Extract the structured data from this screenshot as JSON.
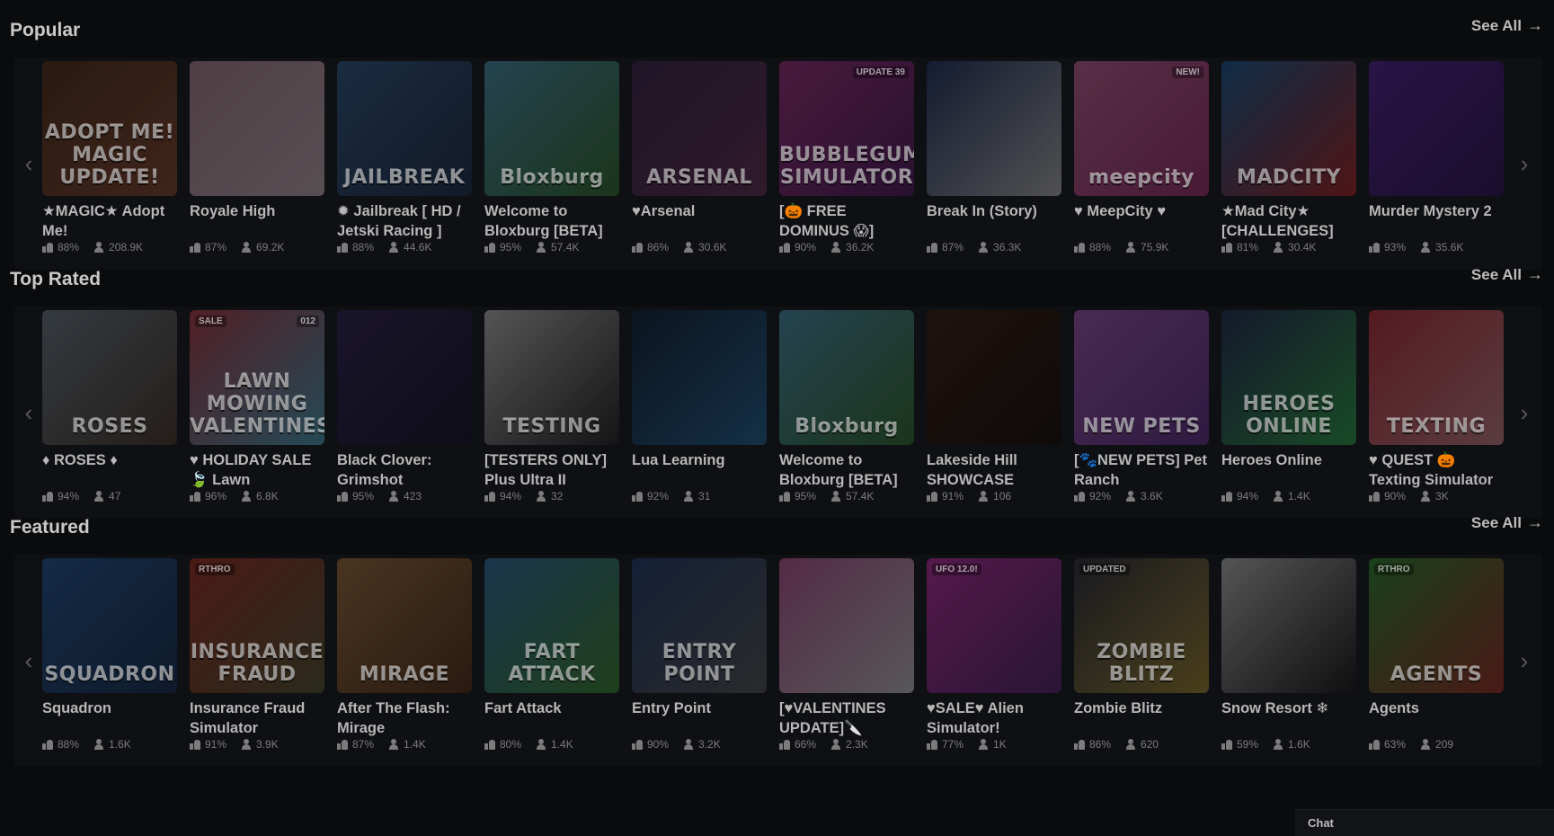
{
  "sections": [
    {
      "title": "Popular",
      "see_all": "See All",
      "games": [
        {
          "name": "★MAGIC★ Adopt Me!",
          "likes": "88%",
          "players": "208.9K",
          "thumb_text": "ADOPT ME! MAGIC UPDATE!",
          "colors": [
            "#6b3a1c",
            "#a8593a"
          ]
        },
        {
          "name": "Royale High",
          "likes": "87%",
          "players": "69.2K",
          "thumb_text": "",
          "colors": [
            "#d9a9b8",
            "#f3d6de"
          ]
        },
        {
          "name": "✹ Jailbreak [ HD / Jetski Racing ]",
          "likes": "88%",
          "players": "44.6K",
          "thumb_text": "JAILBREAK",
          "colors": [
            "#3d6ea8",
            "#243a5f"
          ]
        },
        {
          "name": "Welcome to Bloxburg [BETA]",
          "likes": "95%",
          "players": "57.4K",
          "thumb_text": "Bloxburg",
          "colors": [
            "#5db3d8",
            "#3c8a3a"
          ]
        },
        {
          "name": "♥Arsenal",
          "likes": "86%",
          "players": "30.6K",
          "thumb_text": "ARSENAL",
          "colors": [
            "#4b2d5a",
            "#7c3a6a"
          ]
        },
        {
          "name": "[🎃 FREE DOMINUS 😱]",
          "likes": "90%",
          "players": "36.2K",
          "thumb_text": "BUBBLEGUM SIMULATOR",
          "tag": "UPDATE 39",
          "colors": [
            "#c43a9e",
            "#6a1d7a"
          ]
        },
        {
          "name": "Break In (Story)",
          "likes": "87%",
          "players": "36.3K",
          "thumb_text": "",
          "colors": [
            "#2a3f7a",
            "#dcdcdc"
          ]
        },
        {
          "name": "♥ MeepCity ♥",
          "likes": "88%",
          "players": "75.9K",
          "thumb_text": "meepcity",
          "tag": "NEW!",
          "colors": [
            "#f07ab8",
            "#c63a8a"
          ]
        },
        {
          "name": "★Mad City★ [CHALLENGES]",
          "likes": "81%",
          "players": "30.4K",
          "thumb_text": "MADCITY",
          "colors": [
            "#1d6fb8",
            "#d82a2a"
          ]
        },
        {
          "name": "Murder Mystery 2",
          "likes": "93%",
          "players": "35.6K",
          "thumb_text": "",
          "colors": [
            "#6a2ab8",
            "#3a1670"
          ]
        }
      ]
    },
    {
      "title": "Top Rated",
      "see_all": "See All",
      "games": [
        {
          "name": "♦ ROSES ♦",
          "likes": "94%",
          "players": "47",
          "thumb_text": "ROSES",
          "colors": [
            "#8a9aa8",
            "#5a4636"
          ]
        },
        {
          "name": "♥ HOLIDAY SALE 🍃 Lawn",
          "likes": "96%",
          "players": "6.8K",
          "thumb_text": "LAWN MOWING VALENTINES",
          "tag": "012",
          "tag_left": "SALE",
          "colors": [
            "#e04a5a",
            "#5ac8e8"
          ]
        },
        {
          "name": "Black Clover: Grimshot",
          "likes": "95%",
          "players": "423",
          "thumb_text": "",
          "colors": [
            "#3a2a6a",
            "#1a1430"
          ]
        },
        {
          "name": "[TESTERS ONLY] Plus Ultra II",
          "likes": "94%",
          "players": "32",
          "thumb_text": "TESTING",
          "colors": [
            "#e8e8e8",
            "#2a2a2a"
          ]
        },
        {
          "name": "Lua Learning",
          "likes": "92%",
          "players": "31",
          "thumb_text": "",
          "colors": [
            "#0f2a48",
            "#2a7ab8"
          ]
        },
        {
          "name": "Welcome to Bloxburg [BETA]",
          "likes": "95%",
          "players": "57.4K",
          "thumb_text": "Bloxburg",
          "colors": [
            "#5db3d8",
            "#3c8a3a"
          ]
        },
        {
          "name": "Lakeside Hill SHOWCASE",
          "likes": "91%",
          "players": "106",
          "thumb_text": "",
          "colors": [
            "#4a2416",
            "#1a0d08"
          ]
        },
        {
          "name": "[🐾NEW PETS] Pet Ranch",
          "likes": "92%",
          "players": "3.6K",
          "thumb_text": "NEW PETS",
          "colors": [
            "#c86ae0",
            "#7a3aa8"
          ]
        },
        {
          "name": "Heroes Online",
          "likes": "94%",
          "players": "1.4K",
          "thumb_text": "HEROES ONLINE",
          "colors": [
            "#2a3a6a",
            "#3ac85a"
          ]
        },
        {
          "name": "♥ QUEST 🎃 Texting Simulator",
          "likes": "90%",
          "players": "3K",
          "thumb_text": "TEXTING",
          "colors": [
            "#e83a4a",
            "#f8a0a8"
          ]
        }
      ]
    },
    {
      "title": "Featured",
      "see_all": "See All",
      "games": [
        {
          "name": "Squadron",
          "likes": "88%",
          "players": "1.6K",
          "thumb_text": "SQUADRON",
          "colors": [
            "#2a6ab8",
            "#1a3a6a"
          ]
        },
        {
          "name": "Insurance Fraud Simulator",
          "likes": "91%",
          "players": "3.9K",
          "thumb_text": "INSURANCE FRAUD",
          "tag_left": "RTHRO",
          "colors": [
            "#c83a2a",
            "#6a6a3a"
          ]
        },
        {
          "name": "After The Flash: Mirage",
          "likes": "87%",
          "players": "1.4K",
          "thumb_text": "MIRAGE",
          "colors": [
            "#c88a4a",
            "#6a3a1a"
          ]
        },
        {
          "name": "Fart Attack",
          "likes": "80%",
          "players": "1.4K",
          "thumb_text": "FART ATTACK",
          "colors": [
            "#3a8ac8",
            "#4aa83a"
          ]
        },
        {
          "name": "Entry Point",
          "likes": "90%",
          "players": "3.2K",
          "thumb_text": "ENTRY POINT",
          "colors": [
            "#2a4a8a",
            "#6a6a6a"
          ]
        },
        {
          "name": "[♥VALENTINES UPDATE]🔪",
          "likes": "66%",
          "players": "2.3K",
          "thumb_text": "",
          "colors": [
            "#e86ab8",
            "#f0f0f0"
          ]
        },
        {
          "name": "♥SALE♥ Alien Simulator!",
          "likes": "77%",
          "players": "1K",
          "thumb_text": "",
          "tag_left": "UFO 12.0!",
          "colors": [
            "#e83ac8",
            "#6a2a8a"
          ]
        },
        {
          "name": "Zombie Blitz",
          "likes": "86%",
          "players": "620",
          "thumb_text": "ZOMBIE BLITZ",
          "tag_left": "UPDATED",
          "colors": [
            "#3a3a4a",
            "#c8a83a"
          ]
        },
        {
          "name": "Snow Resort ❄",
          "likes": "59%",
          "players": "1.6K",
          "thumb_text": "",
          "colors": [
            "#e8e8e8",
            "#1a1a1a"
          ]
        },
        {
          "name": "Agents",
          "likes": "63%",
          "players": "209",
          "thumb_text": "AGENTS",
          "tag_left": "RTHRO",
          "colors": [
            "#3aa83a",
            "#c83a2a"
          ]
        }
      ]
    }
  ],
  "chat": {
    "label": "Chat"
  }
}
